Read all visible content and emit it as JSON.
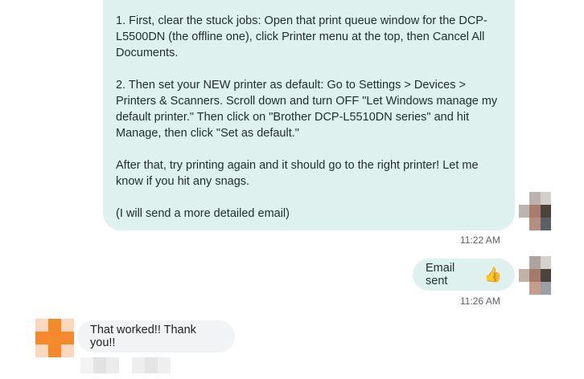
{
  "conversation": {
    "outgoing_long": {
      "paragraphs": [
        "1. First, clear the stuck jobs: Open that print queue window for the DCP-L5500DN (the offline one), click Printer menu at the top, then Cancel All Documents.",
        "2. Then set your NEW printer as default: Go to Settings > Devices > Printers & Scanners. Scroll down and turn OFF \"Let Windows manage my default printer.\" Then click on \"Brother DCP-L5510DN series\" and hit Manage, then click \"Set as default.\"",
        "After that, try printing again and it should go to the right printer! Let me know if you hit any snags.",
        "(I will send a more detailed email)"
      ],
      "timestamp": "11:22 AM"
    },
    "outgoing_short": {
      "text": "Email sent",
      "emoji": "👍",
      "icon": "thumbs-up-icon",
      "timestamp": "11:26 AM"
    },
    "incoming": {
      "text": "That worked!! Thank you!!"
    }
  },
  "colors": {
    "outgoing_bubble": "#dff1ef",
    "incoming_bubble": "#f1f3f4",
    "timestamp_text": "#5f6368",
    "avatar_left_accent": "#f48a2c"
  }
}
